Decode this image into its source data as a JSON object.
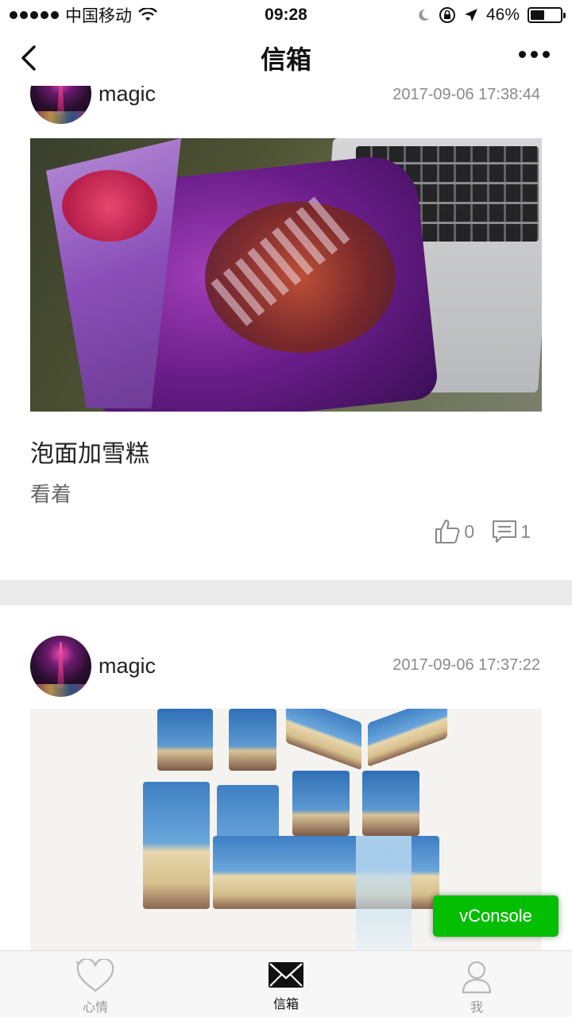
{
  "status_bar": {
    "carrier": "中国移动",
    "time": "09:28",
    "battery": "46%",
    "battery_level": 0.46
  },
  "nav": {
    "title": "信箱"
  },
  "posts": [
    {
      "username": "magic",
      "timestamp": "2017-09-06 17:38:44",
      "title": "泡面加雪糕",
      "body": "看着",
      "likes": "0",
      "comments": "1"
    },
    {
      "username": "magic",
      "timestamp": "2017-09-06 17:37:22"
    }
  ],
  "vconsole": {
    "label": "vConsole"
  },
  "tabs": [
    {
      "label": "心情",
      "icon": "heart-icon",
      "active": false
    },
    {
      "label": "信箱",
      "icon": "envelope-icon",
      "active": true
    },
    {
      "label": "我",
      "icon": "user-icon",
      "active": false
    }
  ],
  "colors": {
    "vconsole_green": "#04be02",
    "separator": "#ebebeb",
    "muted_text": "#8a8a8a",
    "tab_inactive": "#999999"
  }
}
